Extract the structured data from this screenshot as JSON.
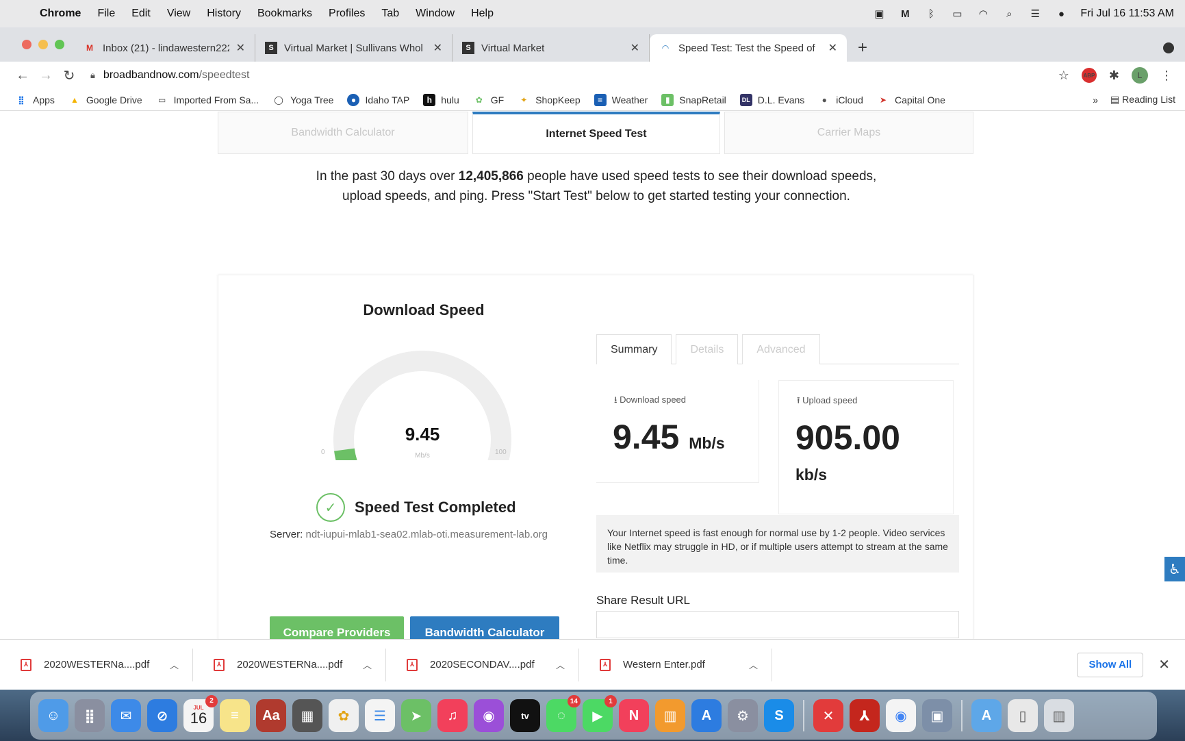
{
  "menubar": {
    "app": "Chrome",
    "items": [
      "File",
      "Edit",
      "View",
      "History",
      "Bookmarks",
      "Profiles",
      "Tab",
      "Window",
      "Help"
    ],
    "status_icons": [
      "display-icon",
      "malwarebytes-icon",
      "bluetooth-icon",
      "battery-icon",
      "wifi-icon",
      "spotlight-icon",
      "control-center-icon",
      "siri-icon"
    ],
    "clock": "Fri Jul 16  11:53 AM"
  },
  "tabs": [
    {
      "title": "Inbox (21) - lindawestern222@",
      "icon": "gmail-icon"
    },
    {
      "title": "Virtual Market | Sullivans Whol",
      "icon": "s-icon"
    },
    {
      "title": "Virtual Market",
      "icon": "s-icon"
    },
    {
      "title": "Speed Test: Test the Speed of",
      "icon": "wifi-icon",
      "active": true
    }
  ],
  "address": {
    "host": "broadbandnow.com",
    "path": "/speedtest"
  },
  "bookmarks": [
    {
      "label": "Apps",
      "icon": "apps-grid-icon",
      "color": "#1a73e8"
    },
    {
      "label": "Google Drive",
      "icon": "google-drive-icon",
      "color": "#f4b400"
    },
    {
      "label": "Imported From Sa...",
      "icon": "folder-icon",
      "color": "#555555"
    },
    {
      "label": "Yoga Tree",
      "icon": "yoga-tree-icon",
      "color": "#333333"
    },
    {
      "label": "Idaho TAP",
      "icon": "idaho-tap-icon",
      "color": "#1a5fb4"
    },
    {
      "label": "hulu",
      "icon": "hulu-icon",
      "color": "#111111"
    },
    {
      "label": "GF",
      "icon": "gf-icon",
      "color": "#6cc066"
    },
    {
      "label": "ShopKeep",
      "icon": "shopkeep-icon",
      "color": "#e2a313"
    },
    {
      "label": "Weather",
      "icon": "weather-icon",
      "color": "#1a5fb4"
    },
    {
      "label": "SnapRetail",
      "icon": "snapretail-icon",
      "color": "#6cc066"
    },
    {
      "label": "D.L. Evans",
      "icon": "dl-evans-icon",
      "color": "#333366"
    },
    {
      "label": "iCloud",
      "icon": "apple-icon",
      "color": "#555555"
    },
    {
      "label": "Capital One",
      "icon": "capital-one-icon",
      "color": "#d03027"
    }
  ],
  "reading_list": "Reading List",
  "page": {
    "top_tabs": [
      "Bandwidth Calculator",
      "Internet Speed Test",
      "Carrier Maps"
    ],
    "intro_pre": "In the past 30 days over ",
    "intro_count": "12,405,866",
    "intro_post": " people have used speed tests to see their download speeds, upload speeds, and ping. Press \"Start Test\" below to get started testing your connection.",
    "gauge": {
      "title": "Download Speed",
      "value": "9.45",
      "value_num": 9.45,
      "unit": "Mb/s",
      "min": "0",
      "max": "100",
      "max_num": 100,
      "fill_color": "#6cc066",
      "track_color": "#eeeeee"
    },
    "status": "Speed Test Completed",
    "server_label": "Server:",
    "server_value": "ndt-iupui-mlab1-sea02.mlab-oti.measurement-lab.org",
    "buttons": {
      "compare": "Compare Providers",
      "bandwidth": "Bandwidth Calculator"
    },
    "result_tabs": [
      "Summary",
      "Details",
      "Advanced"
    ],
    "download": {
      "label": "Download speed",
      "value": "9.45",
      "unit": "Mb/s"
    },
    "upload": {
      "label": "Upload speed",
      "value": "905.00",
      "unit": "kb/s"
    },
    "note": "Your Internet speed is fast enough for normal use by 1-2 people. Video services like Netflix may struggle in HD, or if multiple users attempt to stream at the same time.",
    "share_label": "Share Result URL",
    "accent_blue": "#2e7cc0",
    "accent_green": "#6cc066"
  },
  "downloads": [
    "2020WESTERNa....pdf",
    "2020WESTERNa....pdf",
    "2020SECONDAV....pdf",
    "Western Enter.pdf"
  ],
  "downloads_show_all": "Show All",
  "dock": {
    "calendar_day": "16",
    "calendar_month": "JUL",
    "calendar_badge": "2",
    "messages_badge": "14",
    "facetime_badge": "1"
  }
}
